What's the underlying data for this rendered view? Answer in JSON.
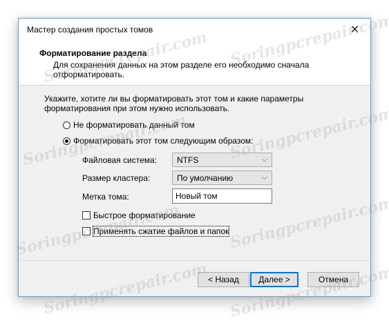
{
  "window": {
    "title": "Мастер создания простых томов",
    "close_glyph": "✕"
  },
  "header": {
    "title": "Форматирование раздела",
    "description": "Для сохранения данных на этом разделе его необходимо сначала отформатировать."
  },
  "content": {
    "intro": "Укажите, хотите ли вы форматировать этот том и какие параметры форматирования при этом нужно использовать.",
    "radio_no_format": {
      "label": "Не форматировать данный том",
      "selected": false
    },
    "radio_format": {
      "label": "Форматировать этот том следующим образом:",
      "selected": true
    },
    "filesystem": {
      "label": "Файловая система:",
      "value": "NTFS"
    },
    "cluster_size": {
      "label": "Размер кластера:",
      "value": "По умолчанию"
    },
    "volume_label": {
      "label": "Метка тома:",
      "value": "Новый том"
    },
    "quick_format": {
      "label": "Быстрое форматирование",
      "checked": false
    },
    "compression": {
      "label": "Применять сжатие файлов и папок",
      "checked": false
    }
  },
  "footer": {
    "back": "< Назад",
    "next": "Далее >",
    "cancel": "Отмена"
  },
  "watermark": "Soringpcrepair.com",
  "colors": {
    "accent": "#0078d7",
    "dialog_bg": "#f0f0f0",
    "header_bg": "#ffffff"
  }
}
